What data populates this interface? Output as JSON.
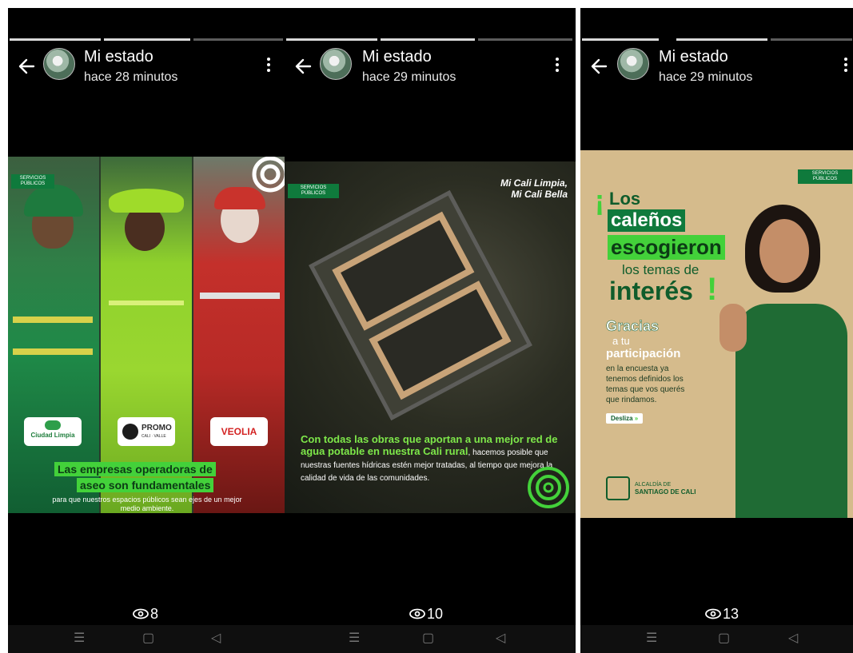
{
  "panels": [
    {
      "header": {
        "title": "Mi estado",
        "time": "hace 28 minutos"
      },
      "views": "8",
      "story": {
        "badge": "SERVICIOS PÚBLICOS",
        "logos": [
          "Ciudad Limpia",
          "PROMO",
          "CALI · VALLE",
          "VEOLIA"
        ],
        "headline_line1": "Las empresas operadoras de",
        "headline_line2": "aseo son fundamentales",
        "body": "para que nuestros espacios públicos sean ejes de un mejor medio ambiente."
      }
    },
    {
      "header": {
        "title": "Mi estado",
        "time": "hace 29 minutos"
      },
      "views": "10",
      "story": {
        "badge": "SERVICIOS PÚBLICOS",
        "brand_line1": "Mi Cali Limpia,",
        "brand_line2": "Mi Cali Bella",
        "headline": "Con todas las obras que aportan a una mejor red de agua potable en nuestra",
        "highlight": "Cali rural",
        "body": ", hacemos posible que nuestras fuentes hídricas estén mejor tratadas, al tiempo que mejora la calidad de vida de las comunidades."
      }
    },
    {
      "header": {
        "title": "Mi estado",
        "time": "hace 29 minutos"
      },
      "views": "13",
      "story": {
        "badge": "SERVICIOS PÚBLICOS",
        "excl_open": "¡",
        "l1": "Los",
        "l2": "caleños",
        "l3": "escogieron",
        "l4": "los temas de",
        "l5": "interés",
        "excl_close": "!",
        "g1": "Gracias",
        "g2": "a tu",
        "g3": "participación",
        "body": "en la encuesta ya tenemos definidos los temas que vos querés que rindamos.",
        "cta": "Desliza",
        "footer_line1": "ALCALDÍA DE",
        "footer_line2": "SANTIAGO DE CALI"
      }
    }
  ],
  "nav": {
    "menu": "☰",
    "home": "▢",
    "back": "◁"
  },
  "icons": {
    "back": "arrow-left",
    "menu": "more-vertical",
    "views": "eye"
  },
  "colors": {
    "accent_green": "#7ee84a",
    "dark_green": "#0f7a3c",
    "background": "#000000"
  }
}
